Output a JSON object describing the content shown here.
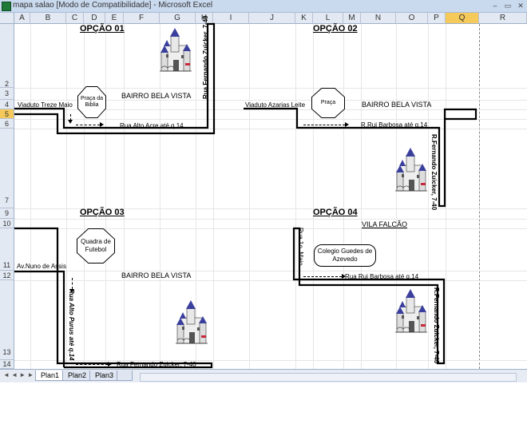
{
  "window": {
    "title": "mapa salao  [Modo de Compatibilidade] - Microsoft Excel",
    "minimize": "–",
    "restore": "▭",
    "close": "✕"
  },
  "columns": [
    "A",
    "B",
    "C",
    "D",
    "E",
    "F",
    "G",
    "H",
    "I",
    "J",
    "K",
    "L",
    "M",
    "N",
    "O",
    "P",
    "Q",
    "R"
  ],
  "selected_column": "Q",
  "rows": [
    "2",
    "3",
    "4",
    "5",
    "6",
    "7",
    "9",
    "10",
    "11",
    "12",
    "13",
    "14"
  ],
  "selected_row": "5",
  "opcao1": {
    "title": "OPÇÃO 01",
    "bairro": "BAIRRO BELA VISTA",
    "viaduto": "Viaduto Treze Maio",
    "praca": "Praça da Biblia",
    "rua1": "Rua Alto Acre até q.14",
    "rua2": "Rua Fernando Zuicker, 7-40"
  },
  "opcao2": {
    "title": "OPÇÃO 02",
    "bairro": "BAIRRO BELA VISTA",
    "viaduto": "Viaduto Azarias Leite",
    "praca": "Praça",
    "rua1": "R.Rui Barbosa até q.14",
    "rua2": "R.Fernando Zuicker, 7-40"
  },
  "opcao3": {
    "title": "OPÇÃO 03",
    "bairro": "BAIRRO BELA VISTA",
    "av": "Av.Nuno de Assis",
    "quadra": "Quadra de Futebol",
    "rua1": "Rua Alto Purus até q.14",
    "rua2": "Rua Fernando Zuicker, 7-40"
  },
  "opcao4": {
    "title": "OPÇÃO 04",
    "vila": "VILA FALCÃO",
    "rua_maio": "Rua 1o. Maio",
    "colegio": "Colegio  Guedes de Azevedo",
    "rua1": "Rua Rui Barbosa até q.14",
    "rua2": "R.Fernando Zuicker, 7-40"
  },
  "sheets": {
    "nav": "◄ ◄ ► ►",
    "tabs": [
      "Plan1",
      "Plan2",
      "Plan3"
    ],
    "active": "Plan1"
  },
  "colors": {
    "header": "#e3e9f3",
    "selected_header": "#f5c95a",
    "titlebar": "#c9d9ee"
  }
}
